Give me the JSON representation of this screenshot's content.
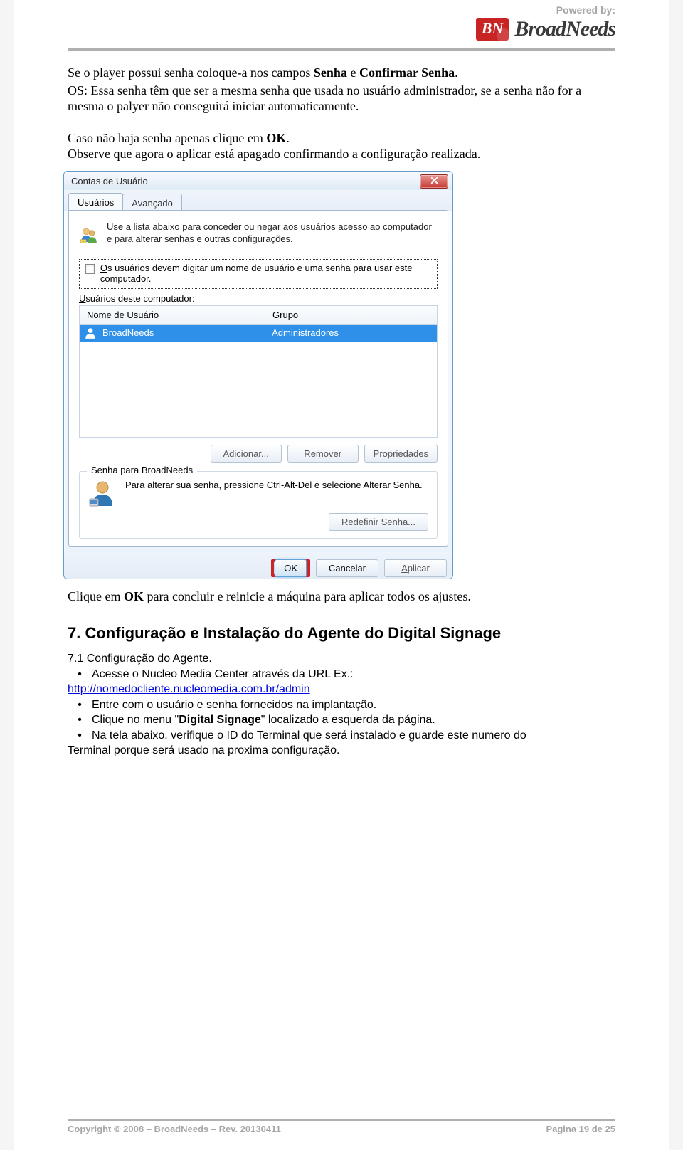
{
  "header": {
    "powered": "Powered by:",
    "badge": "BN",
    "brand": "BroadNeeds"
  },
  "body": {
    "p1_a": "Se o player possui senha coloque-a nos campos ",
    "p1_b1": "Senha",
    "p1_mid": " e ",
    "p1_b2": "Confirmar Senha",
    "p1_end": ".",
    "p2": "OS: Essa senha têm que ser a mesma senha que usada no usuário administrador, se a senha não for a mesma o palyer não conseguirá iniciar automaticamente.",
    "p3a": "Caso não haja senha apenas clique em ",
    "p3a_b": "OK",
    "p3a_end": ".",
    "p3b": "Observe que agora o aplicar está apagado confirmando a configuração realizada.",
    "okp_a": "Clique em ",
    "okp_b": "OK",
    "okp_c": " para concluir e reinicie a máquina para aplicar todos os ajustes.",
    "h2": "7. Configuração e Instalação do Agente do Digital Signage",
    "h3": "7.1 Configuração do Agente.",
    "b1": "Acesse o Nucleo Media Center através da URL Ex.:",
    "link": "http://nomedocliente.nucleomedia.com.br/admin",
    "b2": "Entre com o usuário e senha fornecidos na implantação.",
    "b3a": "Clique no menu \"",
    "b3b": "Digital Signage",
    "b3c": "\" localizado a esquerda da página.",
    "b4": "Na tela abaixo, verifique o ID do Terminal que será instalado e guarde este numero do",
    "b4cont": "Terminal porque será usado na proxima configuração."
  },
  "dialog": {
    "title": "Contas de Usuário",
    "close": "×",
    "tab1": "Usuários",
    "tab2": "Avançado",
    "intro": "Use a lista abaixo para conceder ou negar aos usuários acesso ao computador e para alterar senhas e outras configurações.",
    "chk_label_a": "O",
    "chk_label_b": "s usuários devem digitar um nome de usuário e uma senha para usar este computador.",
    "sub_ul": "U",
    "sub_rest": "suários deste computador:",
    "col1": "Nome de Usuário",
    "col2": "Grupo",
    "row_user": "BroadNeeds",
    "row_group": "Administradores",
    "btn_add_ul": "A",
    "btn_add": "dicionar...",
    "btn_rem_ul": "R",
    "btn_rem": "emover",
    "btn_prop_ul": "P",
    "btn_prop": "ropriedades",
    "group_title": "Senha para BroadNeeds",
    "pw_text": "Para alterar sua senha, pressione Ctrl-Alt-Del e selecione Alterar Senha.",
    "btn_redef": "Redefinir Senha...",
    "btn_ok": "OK",
    "btn_cancel": "Cancelar",
    "btn_apply_ul": "A",
    "btn_apply": "plicar"
  },
  "footer": {
    "left": "Copyright © 2008 – BroadNeeds – Rev. 20130411",
    "right": "Pagina 19 de 25"
  }
}
